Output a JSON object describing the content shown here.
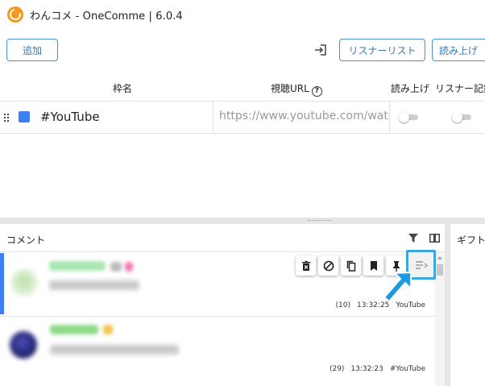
{
  "app": {
    "title": "わんコメ - OneComme | 6.0.4",
    "logo_color": "#f39a1e"
  },
  "toolbar": {
    "add_label": "追加",
    "listener_label": "リスナーリスト",
    "read_label": "読み上げ",
    "accent": "#3678b0"
  },
  "frames_table": {
    "headers": {
      "name": "枠名",
      "url": "視聴URL",
      "read": "読み上げ",
      "listener": "リスナー記録"
    },
    "rows": [
      {
        "color": "#3d7ff2",
        "name": "#YouTube",
        "url_placeholder": "https://www.youtube.com/watch?v=...",
        "read_enabled": false,
        "listener_enabled": false
      }
    ]
  },
  "comment_panel": {
    "title": "コメント",
    "comments": [
      {
        "name_color": "#a8e6b0",
        "meta_count": "(10)",
        "time": "13:32:25",
        "source": "YouTube",
        "selected": true
      },
      {
        "name_color": "#8fd98a",
        "meta_count": "(29)",
        "time": "13:32:23",
        "source": "#YouTube",
        "selected": false
      }
    ],
    "actions": [
      "delete-icon",
      "block-icon",
      "copy-icon",
      "bookmark-icon",
      "pin-icon",
      "read-list-icon"
    ]
  },
  "gift_panel": {
    "title": "ギフト"
  },
  "colors": {
    "highlight": "#3aa6e0",
    "selected_bar": "#3d7ff2"
  }
}
